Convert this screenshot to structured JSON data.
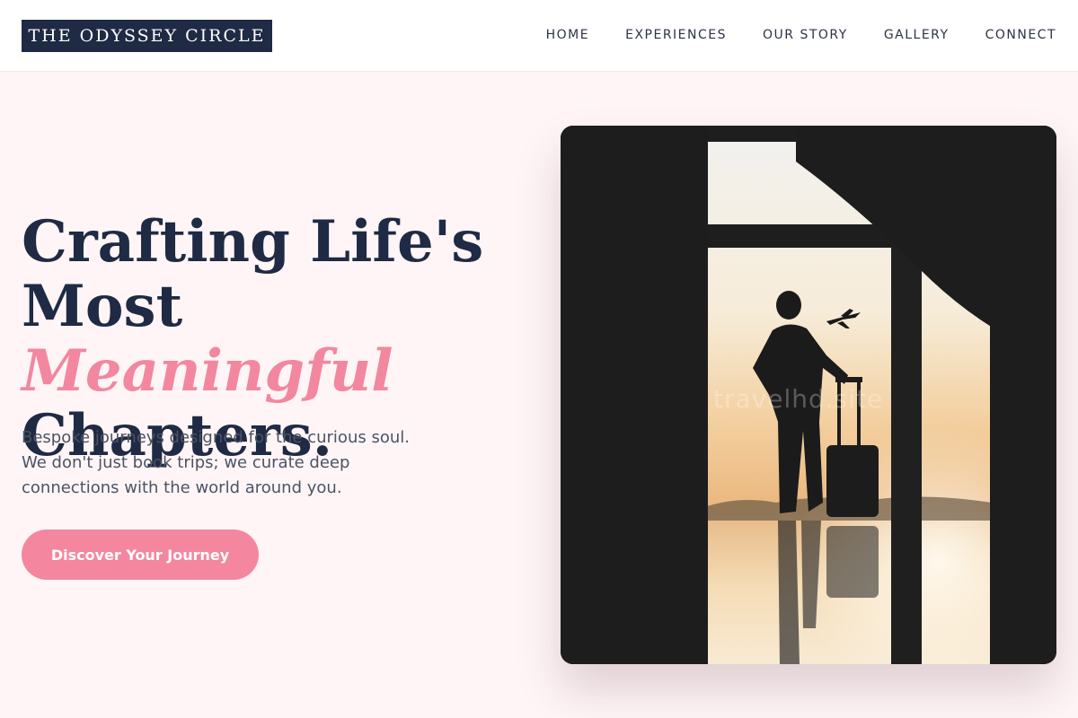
{
  "header": {
    "logo": "THE ODYSSEY CIRCLE",
    "nav": [
      "HOME",
      "EXPERIENCES",
      "OUR STORY",
      "GALLERY",
      "CONNECT"
    ]
  },
  "hero": {
    "headline_line1": "Crafting Life's",
    "headline_line2_prefix": "Most ",
    "headline_line2_accent": "Meaningful",
    "headline_line3": "Chapters.",
    "subtext": "Bespoke journeys designed for the curious soul. We don't just book trips; we curate deep connections with the world around you.",
    "cta_label": "Discover Your Journey",
    "image_watermark": "travelhd.site"
  },
  "colors": {
    "navy": "#1f2a44",
    "accent_pink": "#f2879f",
    "background": "#fff5f6"
  }
}
